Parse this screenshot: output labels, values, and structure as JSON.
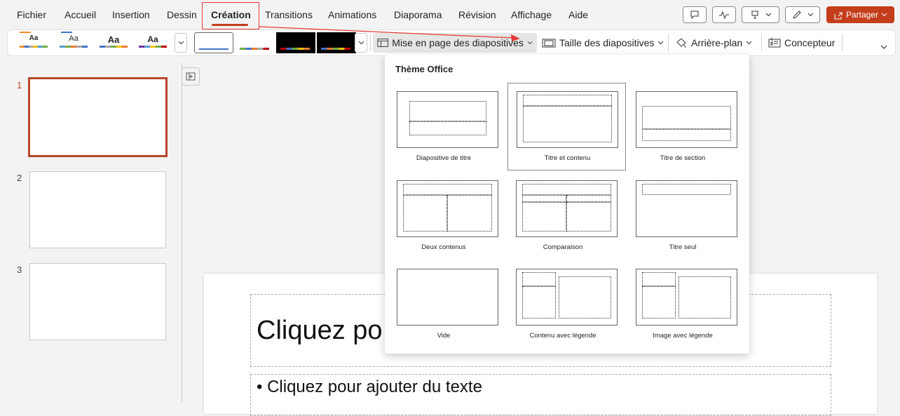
{
  "menu": {
    "tabs": [
      "Fichier",
      "Accueil",
      "Insertion",
      "Dessin",
      "Création",
      "Transitions",
      "Animations",
      "Diaporama",
      "Révision",
      "Affichage",
      "Aide"
    ],
    "active_tab": "Création",
    "share_label": "Partager"
  },
  "ribbon": {
    "theme_label": "Aa",
    "slide_layout_label": "Mise en page des diapositives",
    "slide_size_label": "Taille des diapositives",
    "background_label": "Arrière-plan",
    "designer_label": "Concepteur"
  },
  "slides": {
    "numbers": [
      "1",
      "2",
      "3"
    ]
  },
  "canvas": {
    "title_placeholder": "Cliquez po",
    "body_placeholder": "• Cliquez pour ajouter du texte"
  },
  "layout_panel": {
    "title": "Thème Office",
    "layouts": [
      "Diapositive de titre",
      "Titre et contenu",
      "Titre de section",
      "Deux contenus",
      "Comparaison",
      "Titre seul",
      "Vide",
      "Contenu avec légende",
      "Image avec légende"
    ],
    "selected": "Titre et contenu"
  },
  "colors": {
    "accent": "#c43e1c",
    "selected_slide_border": "#b7472a",
    "annotation": "#e53935"
  }
}
